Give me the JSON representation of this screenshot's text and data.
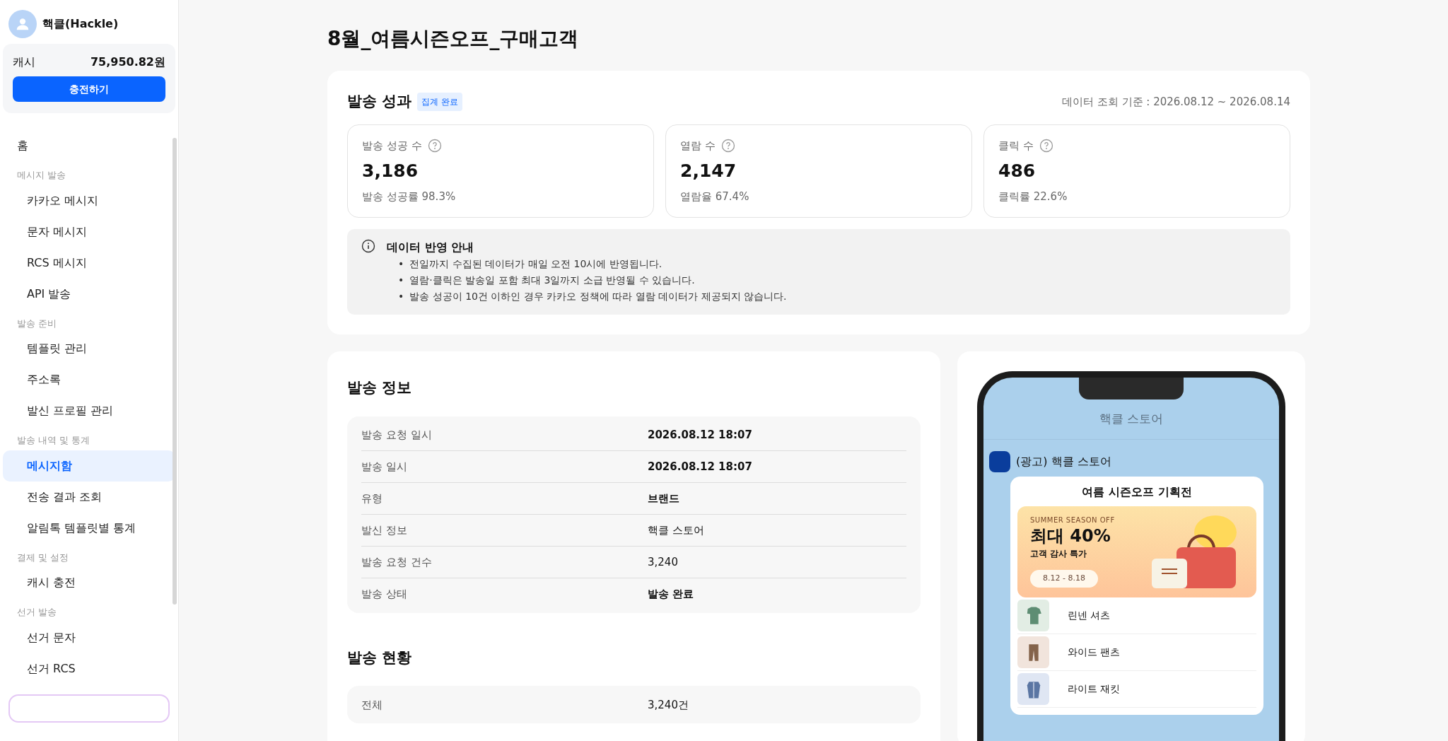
{
  "profile": {
    "name": "핵클(Hackle)"
  },
  "cash": {
    "label": "캐시",
    "amount": "75,950.82원",
    "button": "충전하기"
  },
  "sidebar": {
    "items": [
      {
        "kind": "link",
        "label": "홈",
        "selected": false
      },
      {
        "kind": "section",
        "label": "메시지 발송"
      },
      {
        "kind": "sub",
        "label": "카카오 메시지",
        "selected": false
      },
      {
        "kind": "sub",
        "label": "문자 메시지",
        "selected": false
      },
      {
        "kind": "sub",
        "label": "RCS 메시지",
        "selected": false
      },
      {
        "kind": "sub",
        "label": "API 발송",
        "selected": false
      },
      {
        "kind": "section",
        "label": "발송 준비"
      },
      {
        "kind": "sub",
        "label": "템플릿 관리",
        "selected": false
      },
      {
        "kind": "sub",
        "label": "주소록",
        "selected": false
      },
      {
        "kind": "sub",
        "label": "발신 프로필 관리",
        "selected": false
      },
      {
        "kind": "section",
        "label": "발송 내역 및 통계"
      },
      {
        "kind": "sub",
        "label": "메시지함",
        "selected": true
      },
      {
        "kind": "sub",
        "label": "전송 결과 조회",
        "selected": false
      },
      {
        "kind": "sub",
        "label": "알림톡 템플릿별 통계",
        "selected": false
      },
      {
        "kind": "section",
        "label": "결제 및 설정"
      },
      {
        "kind": "sub",
        "label": "캐시 충전",
        "selected": false
      },
      {
        "kind": "section",
        "label": "선거 발송"
      },
      {
        "kind": "sub",
        "label": "선거 문자",
        "selected": false
      },
      {
        "kind": "sub",
        "label": "선거 RCS",
        "selected": false
      }
    ]
  },
  "page_title": "8월_여름시즌오프_구매고객",
  "performance": {
    "title": "발송 성과",
    "badge": "집계 완료",
    "period": "데이터 조회 기준 : 2026.08.12 ~ 2026.08.14",
    "stats": [
      {
        "label": "발송 성공 수",
        "value": "3,186",
        "rate": "발송 성공률 98.3%"
      },
      {
        "label": "열람 수",
        "value": "2,147",
        "rate": "열람율 67.4%"
      },
      {
        "label": "클릭 수",
        "value": "486",
        "rate": "클릭률 22.6%"
      }
    ],
    "notice": {
      "title": "데이터 반영 안내",
      "bullet": "•",
      "items": [
        "전일까지 수집된 데이터가 매일 오전 10시에 반영됩니다.",
        "열람·클릭은 발송일 포함 최대 3일까지 소급 반영될 수 있습니다.",
        "발송 성공이 10건 이하인 경우 카카오 정책에 따라 열람 데이터가 제공되지 않습니다."
      ]
    }
  },
  "send_info": {
    "title": "발송 정보",
    "rows": [
      {
        "label": "발송 요청 일시",
        "value": "2026.08.12 18:07",
        "emphasis": true
      },
      {
        "label": "발송 일시",
        "value": "2026.08.12 18:07",
        "emphasis": true
      },
      {
        "label": "유형",
        "value": "브랜드",
        "emphasis": true
      },
      {
        "label": "발신 정보",
        "value": "핵클 스토어",
        "emphasis": false
      },
      {
        "label": "발송 요청 건수",
        "value": "3,240",
        "emphasis": false
      },
      {
        "label": "발송 상태",
        "value": "발송 완료",
        "emphasis": true
      }
    ]
  },
  "send_status": {
    "title": "발송 현황",
    "rows": [
      {
        "label": "전체",
        "value": "3,240건",
        "emphasis": false
      }
    ]
  },
  "preview": {
    "header": "핵클 스토어",
    "sender": "(광고) 핵클 스토어",
    "card_title": "여름 시즌오프 기획전",
    "banner": {
      "eyebrow": "SUMMER SEASON OFF",
      "headline": "최대 40%",
      "subline": "고객 감사 특가",
      "dates": "8.12 - 8.18"
    },
    "products": [
      {
        "kind": "shirt",
        "name": "린넨 셔츠"
      },
      {
        "kind": "pants",
        "name": "와이드 팬츠"
      },
      {
        "kind": "jacket",
        "name": "라이트 재킷"
      }
    ]
  }
}
